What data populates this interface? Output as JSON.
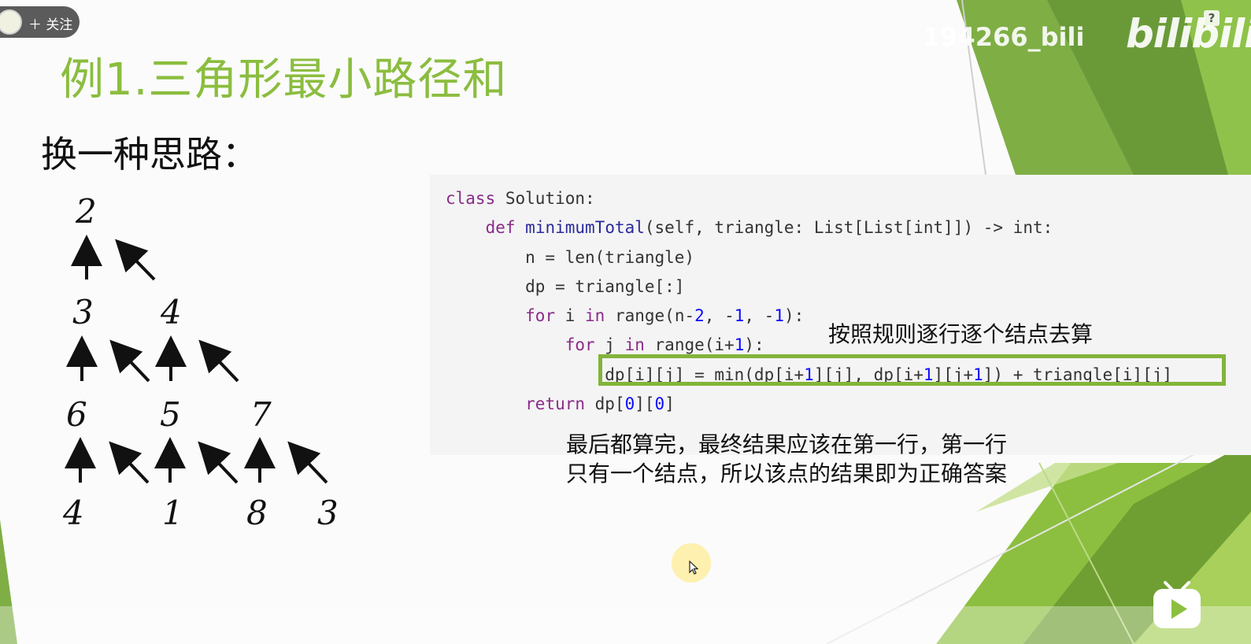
{
  "follow_button": {
    "label": "＋ 关注"
  },
  "watermark": {
    "uid": "194266_bili",
    "logo": "bilibili"
  },
  "help_icon": {
    "label": "?"
  },
  "slide": {
    "title": "例1.三角形最小路径和",
    "subtitle": "换一种思路：",
    "triangle": {
      "rows": [
        [
          "2"
        ],
        [
          "3",
          "4"
        ],
        [
          "6",
          "5",
          "7"
        ],
        [
          "4",
          "1",
          "8",
          "3"
        ]
      ]
    },
    "code": {
      "lines": [
        "class Solution:",
        "    def minimumTotal(self, triangle: List[List[int]]) -> int:",
        "        n = len(triangle)",
        "        dp = triangle[:]",
        "        for i in range(n-2, -1, -1):",
        "            for j in range(i+1):",
        "                dp[i][j] = min(dp[i+1][j], dp[i+1][j+1]) + triangle[i][j]",
        "        return dp[0][0]"
      ]
    },
    "annotation_loop": "按照规则逐行逐个结点去算",
    "annotation_result_line1": "最后都算完，最终结果应该在第一行，第一行",
    "annotation_result_line2": "只有一个结点，所以该点的结果即为正确答案"
  },
  "colors": {
    "accent": "#8bbd3f",
    "highlight_box": "#82b43a",
    "code_bg": "#f4f4f4"
  },
  "icons": [
    "avatar-icon",
    "help-icon",
    "cursor-icon",
    "play-icon",
    "arrow-up-icon",
    "arrow-up-left-icon"
  ]
}
